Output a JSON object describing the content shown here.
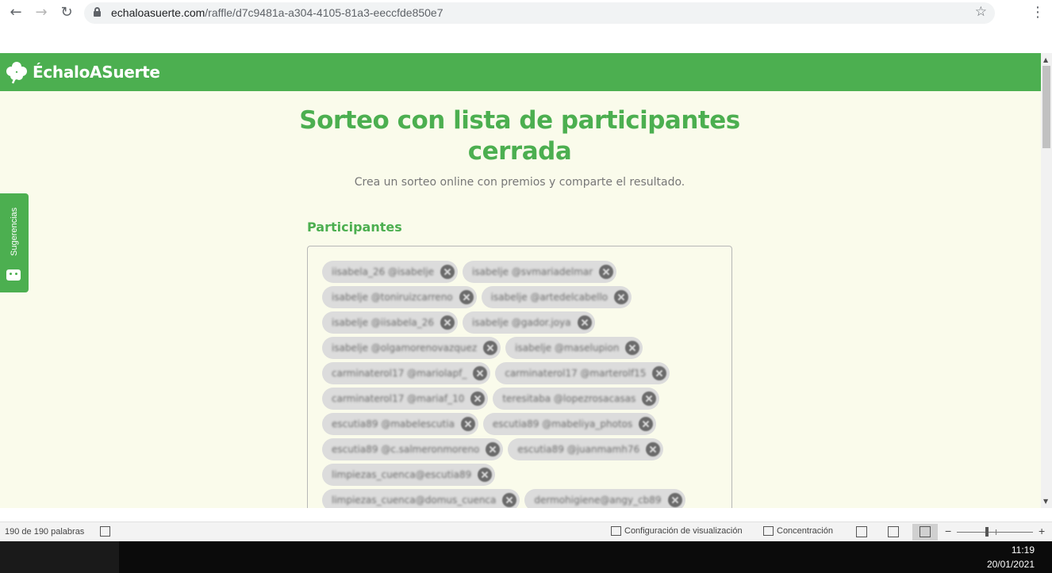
{
  "browser": {
    "url_domain": "echaloasuerte.com",
    "url_path": "/raffle/d7c9481a-a304-4105-81a3-eeccfde850e7"
  },
  "site": {
    "brand": "ÉchaloASuerte",
    "brand_color": "#4caf50"
  },
  "page": {
    "title": "Sorteo con lista de participantes cerrada",
    "subtitle": "Crea un sorteo online con premios y comparte el resultado.",
    "participants_label": "Participantes",
    "feedback_tab": "Sugerencias"
  },
  "participants": [
    [
      "iisabela_26 @isabelje",
      "isabelje @svmariadelmar"
    ],
    [
      "isabelje @toniruizcarreno",
      "isabelje @artedelcabello"
    ],
    [
      "isabelje @iisabela_26",
      "isabelje @gador.joya"
    ],
    [
      "isabelje @olgamorenovazquez",
      "isabelje @maselupion"
    ],
    [
      "carminaterol17 @mariolapf_",
      "carminaterol17 @marterolf15"
    ],
    [
      "carminaterol17 @mariaf_10",
      "teresitaba @lopezrosacasas"
    ],
    [
      "escutia89 @mabelescutia",
      "escutia89 @mabeliya_photos"
    ],
    [
      "escutia89 @c.salmeronmoreno",
      "escutia89 @juanmamh76"
    ],
    [
      "limpiezas_cuenca@escutia89"
    ],
    [
      "limpiezas_cuenca@domus_cuenca",
      "dermohigiene@angy_cb89"
    ]
  ],
  "statusbar": {
    "word_count": "190 de 190 palabras",
    "display_settings": "Configuración de visualización",
    "focus": "Concentración"
  },
  "taskbar": {
    "time": "11:19",
    "date": "20/01/2021"
  }
}
